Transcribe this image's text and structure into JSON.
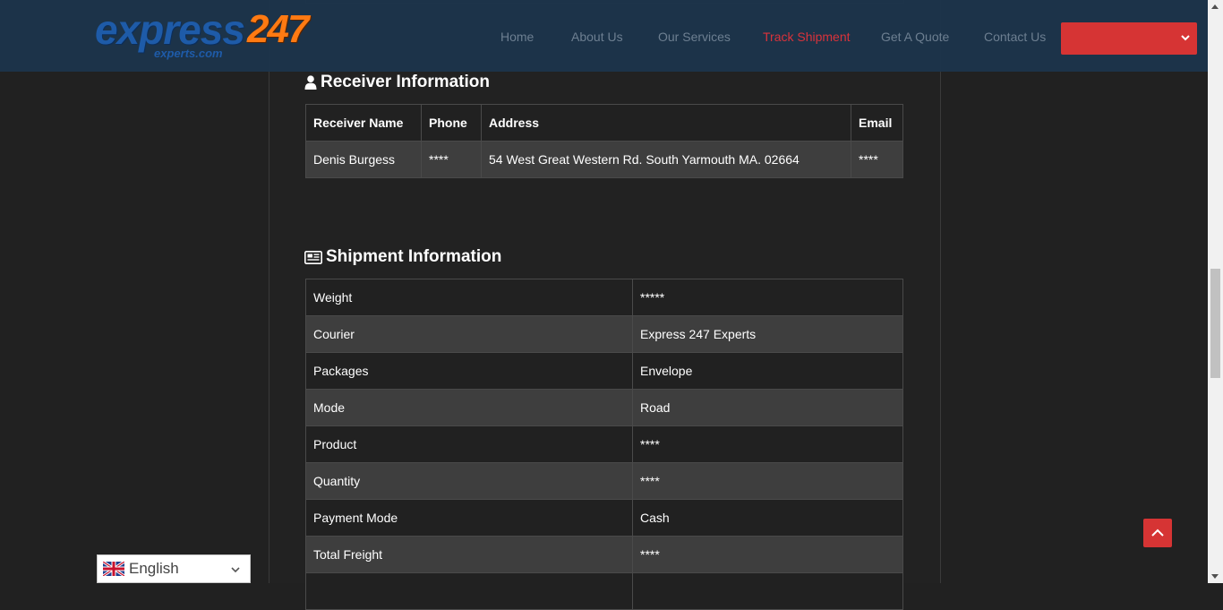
{
  "brand": {
    "logo_word": "express",
    "logo_number": "247",
    "logo_tagline": "experts.com"
  },
  "nav": {
    "items": [
      {
        "label": "Home",
        "active": false
      },
      {
        "label": "About Us",
        "active": false
      },
      {
        "label": "Our Services",
        "active": false
      },
      {
        "label": "Track Shipment",
        "active": true
      },
      {
        "label": "Get A Quote",
        "active": false
      },
      {
        "label": "Contact Us",
        "active": false
      }
    ],
    "language_select_value": ""
  },
  "receiver": {
    "title": "Receiver Information",
    "icon": "user-icon",
    "headers": [
      "Receiver Name",
      "Phone",
      "Address",
      "Email"
    ],
    "row": [
      "Denis Burgess",
      "****",
      "54 West Great Western Rd. South Yarmouth MA. 02664",
      "****"
    ]
  },
  "shipment": {
    "title": "Shipment Information",
    "icon": "newspaper-icon",
    "rows": [
      {
        "label": "Weight",
        "value": "*****"
      },
      {
        "label": "Courier",
        "value": "Express 247 Experts"
      },
      {
        "label": "Packages",
        "value": "Envelope"
      },
      {
        "label": "Mode",
        "value": "Road"
      },
      {
        "label": "Product",
        "value": "****"
      },
      {
        "label": "Quantity",
        "value": "****"
      },
      {
        "label": "Payment Mode",
        "value": "Cash"
      },
      {
        "label": "Total Freight",
        "value": "****"
      },
      {
        "label": "",
        "value": ""
      }
    ]
  },
  "translate": {
    "language": "English",
    "flag": "uk-flag-icon"
  },
  "colors": {
    "accent_red": "#d63434",
    "header_bg": "#1c344a",
    "nav_text": "#6d7f91",
    "nav_active": "#d9333b",
    "page_bg": "#212121",
    "row_alt": "#3e3e3e"
  }
}
